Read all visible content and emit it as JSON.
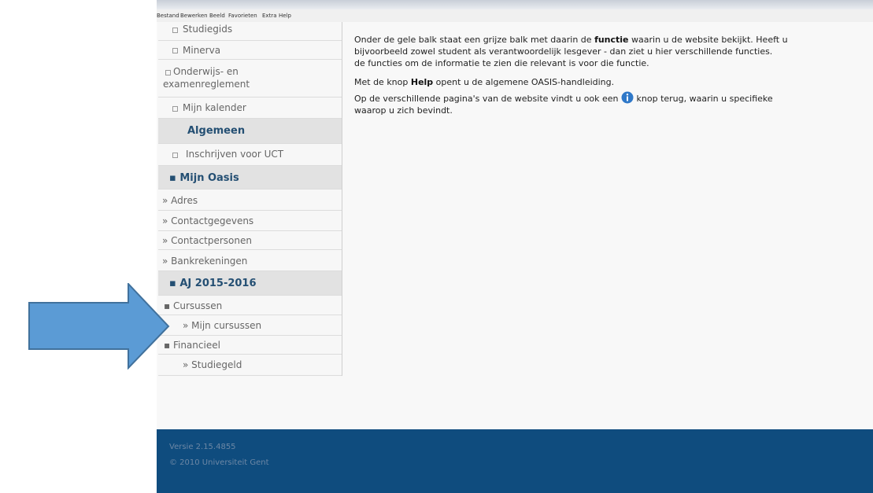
{
  "menubar": {
    "items": [
      "Bestand",
      "Bewerken",
      "Beeld",
      "Favorieten",
      "Extra",
      "Help"
    ]
  },
  "sidebar": {
    "items": [
      {
        "label": "Studiegids"
      },
      {
        "label": "Minerva"
      },
      {
        "label": "Onderwijs- en"
      },
      {
        "label": "examenreglement"
      },
      {
        "label": "Mijn kalender"
      },
      {
        "label": "Algemeen"
      },
      {
        "label": "Inschrijven voor UCT"
      },
      {
        "label": "Mijn Oasis"
      },
      {
        "label": "Adres"
      },
      {
        "label": "Contactgegevens"
      },
      {
        "label": "Contactpersonen"
      },
      {
        "label": "Bankrekeningen"
      },
      {
        "label": "AJ 2015-2016"
      },
      {
        "label": "Cursussen"
      },
      {
        "label": "Mijn cursussen"
      },
      {
        "label": "Financieel"
      },
      {
        "label": "Studiegeld"
      }
    ]
  },
  "main": {
    "p1_line1_a": "Onder de gele balk staat een grijze balk met daarin de ",
    "p1_line1_b": "functie",
    "p1_line1_c": " waarin u de website bekijkt. Heeft u",
    "p1_line2": "bijvoorbeeld zowel student als verantwoordelijk lesgever - dan ziet u hier verschillende functies.",
    "p1_line3": "de functies om de informatie te zien die relevant is voor die functie.",
    "p2_a": "Met de knop ",
    "p2_b": "Help",
    "p2_c": " opent u de algemene OASIS-handleiding.",
    "p3_line1_a": "Op de verschillende pagina's van de website vindt u ook een ",
    "p3_line1_b": " knop terug, waarin u specifieke",
    "p3_line2": "waarop u zich bevindt."
  },
  "footer": {
    "version": "Versie 2.15.4855",
    "copyright": "© 2010 Universiteit Gent"
  },
  "colors": {
    "arrow": "#5b9bd5",
    "footer": "#0f4c7e",
    "section_text": "#244f73"
  }
}
